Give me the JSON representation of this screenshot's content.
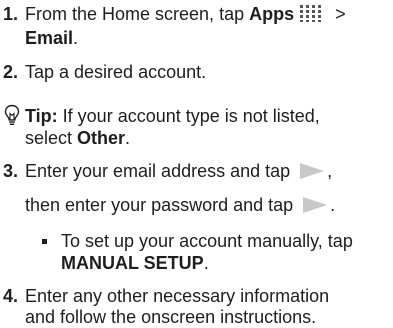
{
  "steps": [
    {
      "number": "1.",
      "text_a": "From the Home screen, tap ",
      "bold_a": "Apps",
      "icon_a": "apps-grid-icon",
      "text_b": " >",
      "bold_b": "Email",
      "text_c": "."
    },
    {
      "number": "2.",
      "text": "Tap a desired account."
    },
    {
      "number": "3.",
      "text_a": "Enter your email address and tap",
      "icon_a": "next-arrow-icon",
      "text_b": ",",
      "text_c": "then enter your password and tap",
      "icon_b": "next-arrow-icon",
      "text_d": "."
    },
    {
      "number": "4.",
      "line_a": "Enter any other necessary information",
      "line_b": "and follow the onscreen instructions."
    }
  ],
  "tip": {
    "icon": "lightbulb-icon",
    "label": "Tip:",
    "text_a": " If your account type is not listed,",
    "text_b": "select ",
    "bold": "Other",
    "text_c": "."
  },
  "bullet": {
    "text_a": "To set up your account manually, tap",
    "bold": "MANUAL SETUP",
    "text_b": "."
  },
  "colors": {
    "text": "#1e1e1e",
    "icon_gray": "#c8c8c8"
  }
}
